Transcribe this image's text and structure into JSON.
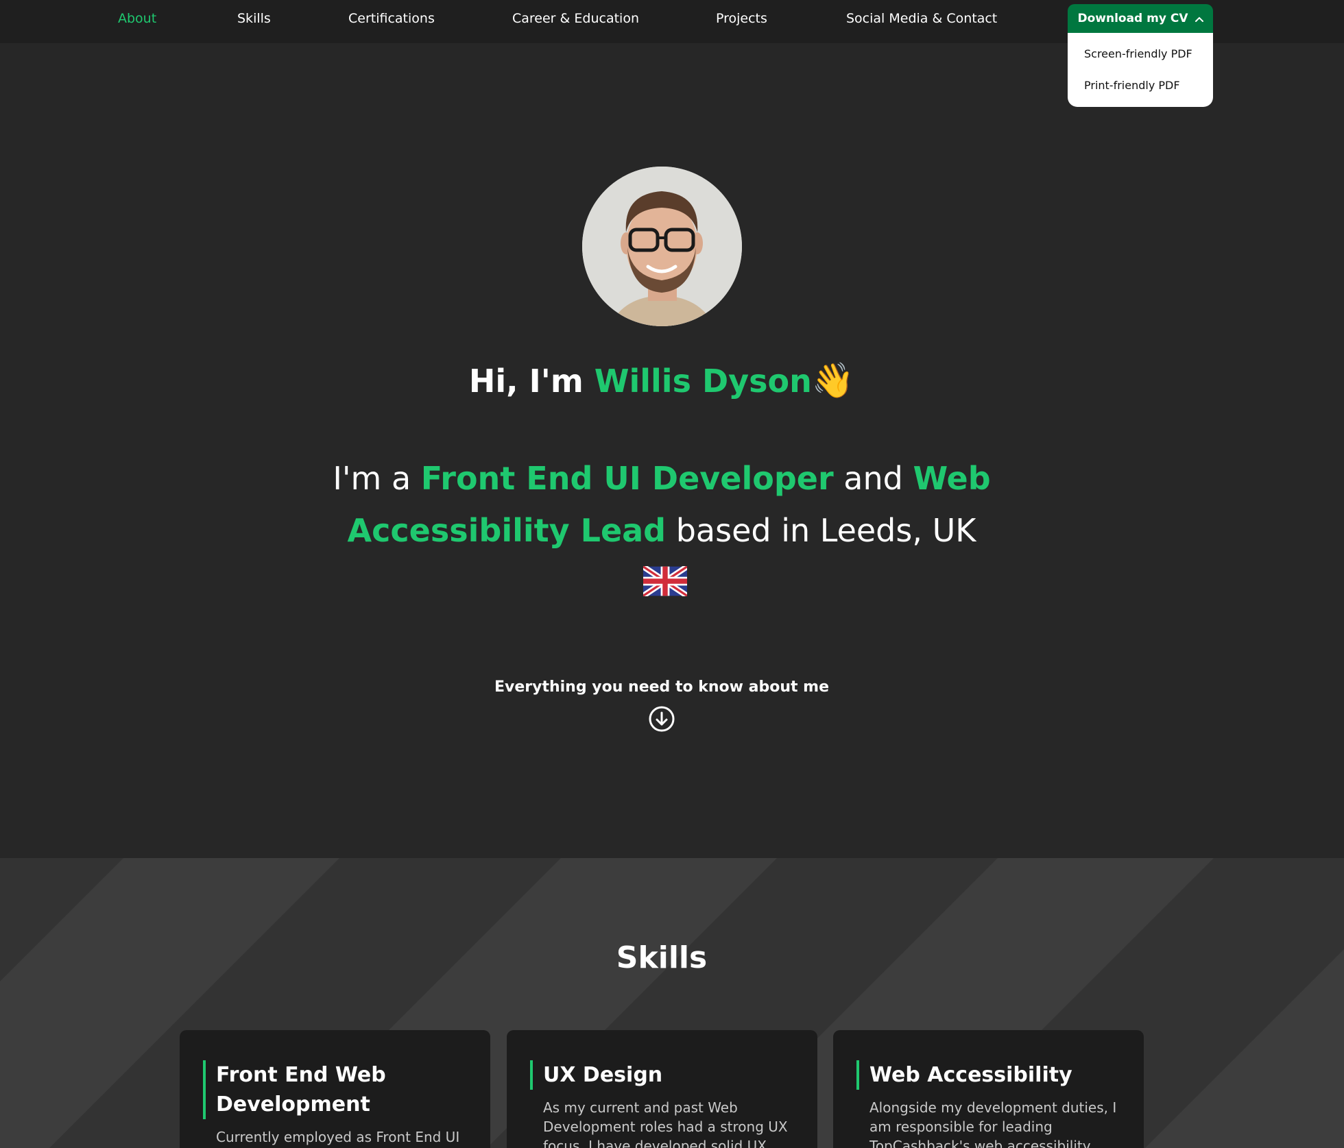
{
  "nav": {
    "items": [
      {
        "label": "About",
        "active": true
      },
      {
        "label": "Skills"
      },
      {
        "label": "Certifications"
      },
      {
        "label": "Career & Education"
      },
      {
        "label": "Projects"
      },
      {
        "label": "Social Media & Contact"
      }
    ],
    "cv_button": "Download my CV",
    "cv_menu": [
      "Screen-friendly PDF",
      "Print-friendly PDF"
    ]
  },
  "hero": {
    "greeting_prefix": "Hi, I'm ",
    "name": "Willis Dyson",
    "wave_emoji": "👋",
    "tag_1": "I'm a ",
    "role_1": "Front End UI Developer",
    "tag_2": " and ",
    "role_2": "Web Accessibility Lead",
    "tag_3": " based in Leeds, UK",
    "flag": "uk-flag",
    "scroll_text": "Everything you need to know about me",
    "scroll_icon": "arrow-down-circle-icon"
  },
  "skills": {
    "title": "Skills",
    "cards": [
      {
        "heading": "Front End Web Development",
        "body": "Currently employed as Front End UI"
      },
      {
        "heading": "UX Design",
        "body": "As my current and past Web Development roles had a strong UX focus, I have developed solid UX"
      },
      {
        "heading": "Web Accessibility",
        "body": "Alongside my development duties, I am responsible for leading TopCashback's web accessibility"
      }
    ]
  },
  "colors": {
    "accent": "#1fc86f",
    "cv_button": "#00773f",
    "background": "#272727",
    "nav": "#1f1f1f"
  }
}
